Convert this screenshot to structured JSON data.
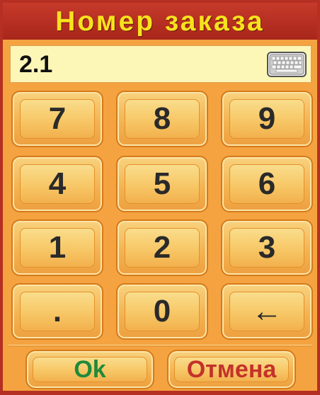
{
  "dialog": {
    "title": "Номер заказа",
    "input_value": "2.1",
    "keypad": [
      "7",
      "8",
      "9",
      "4",
      "5",
      "6",
      "1",
      "2",
      "3",
      ".",
      "0",
      "←"
    ],
    "ok_label": "Ok",
    "cancel_label": "Отмена"
  },
  "colors": {
    "title_bar": "#b52f22",
    "title_text": "#f7e21e",
    "background": "#f4a340",
    "entry_background": "#fdf7b7",
    "ok_text": "#1f8a3a",
    "cancel_text": "#c3322a"
  },
  "icons": {
    "keyboard": "keyboard-icon",
    "backspace": "backspace-arrow"
  }
}
